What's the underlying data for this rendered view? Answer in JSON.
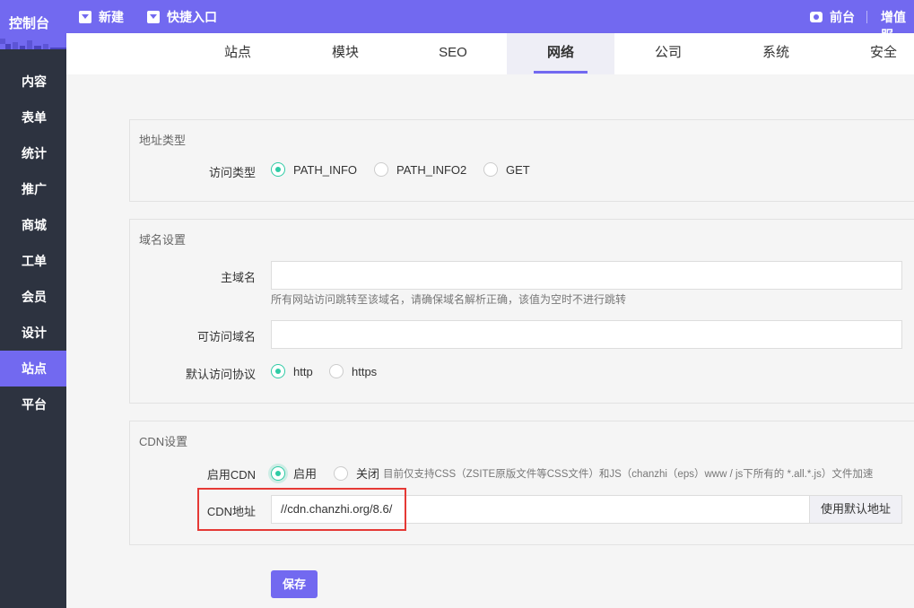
{
  "topbar": {
    "logo": "控制台",
    "new_label": "新建",
    "shortcut_label": "快捷入口",
    "frontend_label": "前台",
    "value_added_label": "增值服"
  },
  "sidebar": {
    "items": [
      "内容",
      "表单",
      "统计",
      "推广",
      "商城",
      "工单",
      "会员",
      "设计",
      "站点",
      "平台"
    ],
    "active_index": 8
  },
  "tabs": {
    "items": [
      "站点",
      "模块",
      "SEO",
      "网络",
      "公司",
      "系统",
      "安全"
    ],
    "active_index": 3
  },
  "address_type": {
    "title": "地址类型",
    "label": "访问类型",
    "options": [
      "PATH_INFO",
      "PATH_INFO2",
      "GET"
    ],
    "selected": "PATH_INFO"
  },
  "domain": {
    "title": "域名设置",
    "main_label": "主域名",
    "main_value": "",
    "main_help": "所有网站访问跳转至该域名，请确保域名解析正确，该值为空时不进行跳转",
    "allowed_label": "可访问域名",
    "allowed_value": "",
    "protocol_label": "默认访问协议",
    "protocol_options": [
      "http",
      "https"
    ],
    "protocol_selected": "http"
  },
  "cdn": {
    "title": "CDN设置",
    "enable_label": "启用CDN",
    "on_label": "启用",
    "off_label": "关闭",
    "note": "目前仅支持CSS（ZSITE原版文件等CSS文件）和JS（chanzhi（eps）www / js下所有的 *.all.*.js）文件加速",
    "address_label": "CDN地址",
    "address_value": "//cdn.chanzhi.org/8.6/",
    "default_button": "使用默认地址"
  },
  "save_label": "保存",
  "colors": {
    "accent": "#7269f0",
    "sidebar": "#2d3340",
    "radio_on": "#2fcba5",
    "highlight": "#e53935"
  }
}
